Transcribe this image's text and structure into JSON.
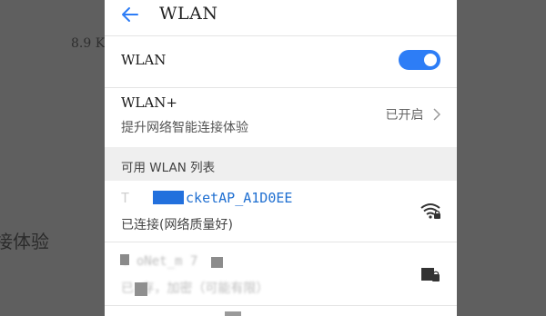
{
  "background": {
    "size_text": "8.9 K",
    "experience_text": "接体验"
  },
  "appbar": {
    "back_icon": "arrow-left-icon",
    "title": "WLAN"
  },
  "wlan_row": {
    "label": "WLAN",
    "toggle_on": true,
    "toggle_color": "#2d7df6"
  },
  "wlan_plus_row": {
    "label": "WLAN+",
    "subtitle": "提升网络智能连接体验",
    "status": "已开启",
    "chevron_icon": "chevron-right-icon"
  },
  "section": {
    "label": "可用 WLAN 列表"
  },
  "networks": [
    {
      "name_prefix": "T",
      "name_suffix": "cketAP_A1D0EE",
      "status": "已连接(网络质量好)",
      "icon": "wifi-lock-icon",
      "accent_color": "#1f6fd1"
    },
    {
      "name_blurred": "C    oNet_m 7",
      "status_blurred": "已    存，加密（可能有限）",
      "icon": "signal-lock-icon"
    }
  ]
}
